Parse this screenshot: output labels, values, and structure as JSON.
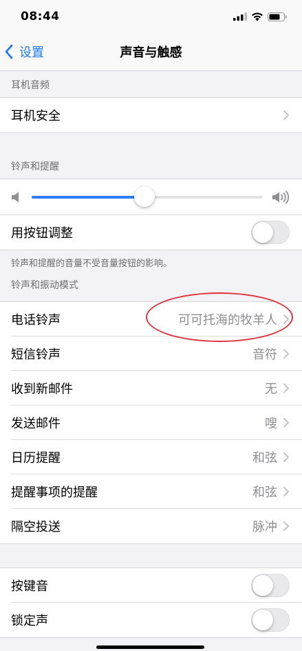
{
  "status": {
    "time": "08:44"
  },
  "nav": {
    "back_label": "设置",
    "title": "声音与触感"
  },
  "headphone": {
    "header": "耳机音频",
    "safety_label": "耳机安全"
  },
  "ringer": {
    "header": "铃声和提醒",
    "volume_level": 0.49,
    "change_with_buttons_label": "用按钮调整",
    "change_with_buttons_on": false,
    "footer": "铃声和提醒的音量不受音量按钮的影响。"
  },
  "patterns": {
    "header": "铃声和振动模式",
    "items": [
      {
        "label": "电话铃声",
        "value": "可可托海的牧羊人"
      },
      {
        "label": "短信铃声",
        "value": "音符"
      },
      {
        "label": "收到新邮件",
        "value": "无"
      },
      {
        "label": "发送邮件",
        "value": "嗖"
      },
      {
        "label": "日历提醒",
        "value": "和弦"
      },
      {
        "label": "提醒事项的提醒",
        "value": "和弦"
      },
      {
        "label": "隔空投送",
        "value": "脉冲"
      }
    ]
  },
  "system_sounds": {
    "keyboard_clicks_label": "按键音",
    "keyboard_clicks_on": false,
    "lock_sound_label": "锁定声",
    "lock_sound_on": false
  },
  "colors": {
    "accent": "#1e7cf2",
    "slider_fill": "#2d7cf6",
    "annotation": "#e0333b"
  }
}
